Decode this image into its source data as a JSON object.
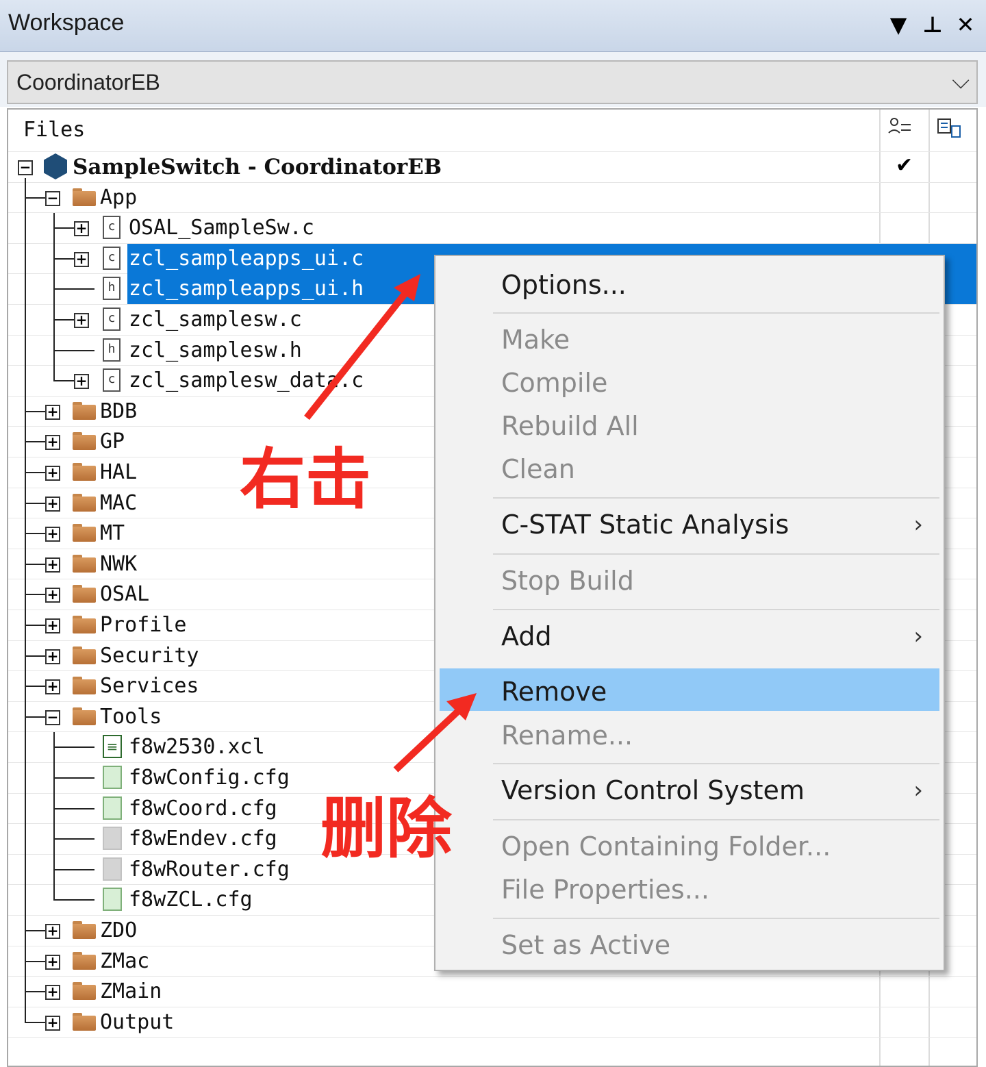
{
  "window": {
    "title": "Workspace",
    "buttons": [
      "▼",
      "⊥",
      "✕"
    ]
  },
  "config": {
    "value": "CoordinatorEB"
  },
  "tree": {
    "header": "Files",
    "root": "SampleSwitch - CoordinatorEB",
    "rows": [
      {
        "label": "App",
        "kind": "folder",
        "expanded": true
      },
      {
        "label": "OSAL_SampleSw.c",
        "kind": "c"
      },
      {
        "label": "zcl_sampleapps_ui.c",
        "kind": "c",
        "selected": true
      },
      {
        "label": "zcl_sampleapps_ui.h",
        "kind": "h",
        "selected": true
      },
      {
        "label": "zcl_samplesw.c",
        "kind": "c"
      },
      {
        "label": "zcl_samplesw.h",
        "kind": "h"
      },
      {
        "label": "zcl_samplesw_data.c",
        "kind": "c"
      },
      {
        "label": "BDB",
        "kind": "folder"
      },
      {
        "label": "GP",
        "kind": "folder"
      },
      {
        "label": "HAL",
        "kind": "folder"
      },
      {
        "label": "MAC",
        "kind": "folder"
      },
      {
        "label": "MT",
        "kind": "folder"
      },
      {
        "label": "NWK",
        "kind": "folder"
      },
      {
        "label": "OSAL",
        "kind": "folder"
      },
      {
        "label": "Profile",
        "kind": "folder"
      },
      {
        "label": "Security",
        "kind": "folder"
      },
      {
        "label": "Services",
        "kind": "folder"
      },
      {
        "label": "Tools",
        "kind": "folder",
        "expanded": true
      },
      {
        "label": "f8w2530.xcl",
        "kind": "xcl"
      },
      {
        "label": "f8wConfig.cfg",
        "kind": "cfg"
      },
      {
        "label": "f8wCoord.cfg",
        "kind": "cfg"
      },
      {
        "label": "f8wEndev.cfg",
        "kind": "cfg-gray"
      },
      {
        "label": "f8wRouter.cfg",
        "kind": "cfg-gray"
      },
      {
        "label": "f8wZCL.cfg",
        "kind": "cfg"
      },
      {
        "label": "ZDO",
        "kind": "folder"
      },
      {
        "label": "ZMac",
        "kind": "folder"
      },
      {
        "label": "ZMain",
        "kind": "folder"
      },
      {
        "label": "Output",
        "kind": "folder"
      }
    ]
  },
  "context_menu": {
    "items": [
      {
        "label": "Options...",
        "enabled": true
      },
      {
        "label": "Make",
        "enabled": false
      },
      {
        "label": "Compile",
        "enabled": false
      },
      {
        "label": "Rebuild All",
        "enabled": false
      },
      {
        "label": "Clean",
        "enabled": false
      },
      {
        "label": "C-STAT Static Analysis",
        "enabled": true,
        "submenu": true
      },
      {
        "label": "Stop Build",
        "enabled": false
      },
      {
        "label": "Add",
        "enabled": true,
        "submenu": true
      },
      {
        "label": "Remove",
        "enabled": true,
        "highlighted": true
      },
      {
        "label": "Rename...",
        "enabled": false
      },
      {
        "label": "Version Control System",
        "enabled": true,
        "submenu": true
      },
      {
        "label": "Open Containing Folder...",
        "enabled": false
      },
      {
        "label": "File Properties...",
        "enabled": false
      },
      {
        "label": "Set as Active",
        "enabled": false
      }
    ]
  },
  "annotations": {
    "right_click": "右击",
    "delete": "删除",
    "color": "#f22a21"
  },
  "colors": {
    "selection": "#0a78d7",
    "menu_highlight": "#91c9f7"
  }
}
